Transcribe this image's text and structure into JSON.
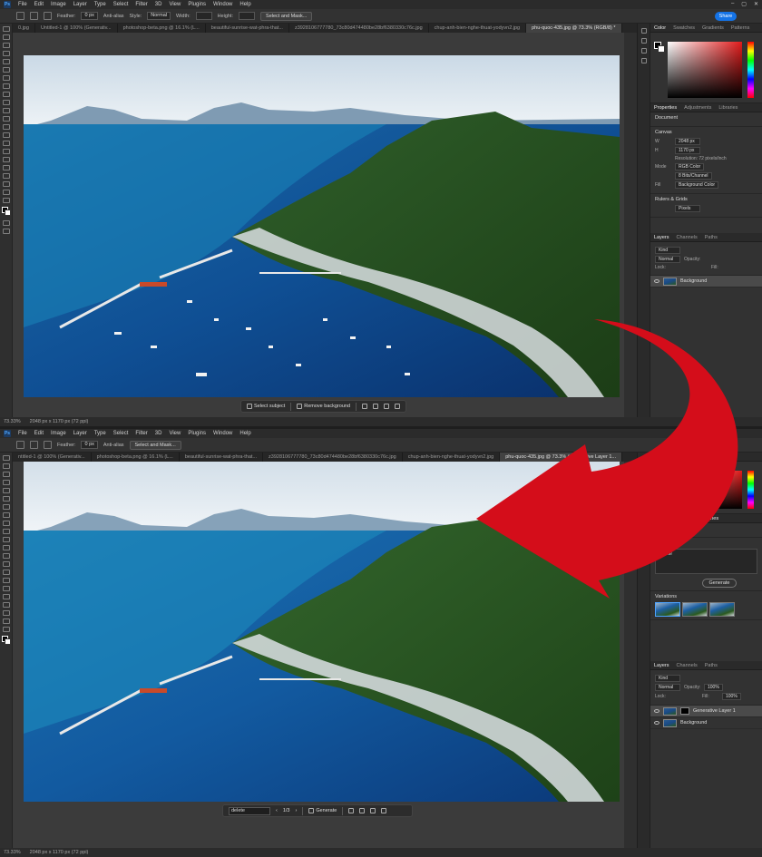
{
  "menu": [
    "File",
    "Edit",
    "Image",
    "Layer",
    "Type",
    "Select",
    "Filter",
    "3D",
    "View",
    "Plugins",
    "Window",
    "Help"
  ],
  "app_logo": "Ps",
  "window_controls": [
    "–",
    "▢",
    "✕"
  ],
  "top": {
    "options": {
      "feather_label": "Feather:",
      "feather_value": "0 px",
      "antialias": "Anti-alias",
      "style_label": "Style:",
      "style_value": "Normal",
      "width_label": "Width:",
      "height_label": "Height:",
      "select_mask": "Select and Mask..."
    },
    "share": "Share",
    "tabs": [
      "0.jpg",
      "Untitled-1 @ 100% (Generativ...",
      "photoshop-beta.png @ 16.1% (L...",
      "beautiful-sunrise-wat-phra-that...",
      "z3928106777780_73c80d474480be28bf6380330c76c.jpg",
      "chup-anh-bien-nghe-thuat-yodyvn2.jpg",
      "phu-quoc-435.jpg @ 73.3% (RGB/8) *"
    ],
    "context_bar": {
      "select_subject": "Select subject",
      "remove_background": "Remove background"
    },
    "status": {
      "zoom": "73.33%",
      "info": "2048 px x 1170 px (72 ppi)"
    },
    "color_tabs": [
      "Color",
      "Swatches",
      "Gradients",
      "Patterns"
    ],
    "props_tabs": [
      "Properties",
      "Adjustments",
      "Libraries"
    ],
    "document": "Document",
    "canvas": {
      "title": "Canvas",
      "w_label": "W",
      "w": "2048 px",
      "h_label": "H",
      "h": "1170 px",
      "resolution": "Resolution: 72 pixels/inch",
      "mode_label": "Mode",
      "mode": "RGB Color",
      "bits": "8 Bits/Channel",
      "fill_label": "Fill",
      "fill": "Background Color"
    },
    "rulers": {
      "title": "Rulers & Grids",
      "unit": "Pixels"
    },
    "layers_tabs": [
      "Layers",
      "Channels",
      "Paths"
    ],
    "layers": {
      "kind": "Kind",
      "blend": "Normal",
      "opacity_label": "Opacity:",
      "fill_label": "Fill:",
      "lock_label": "Lock:",
      "items": [
        "Background"
      ]
    }
  },
  "bottom": {
    "options": {
      "feather_label": "Feather:",
      "feather_value": "0 px",
      "antialias": "Anti-alias",
      "select_mask": "Select and Mask..."
    },
    "tabs": [
      "ntitled-1 @ 100% (Generativ...",
      "photoshop-beta.png @ 16.1% (L...",
      "beautiful-sunrise-wat-phra-that...",
      "z3928106777780_73c80d474480be28bf6380330c76c.jpg",
      "chup-anh-bien-nghe-thuat-yodyvn2.jpg",
      "phu-quoc-435.jpg @ 73.3% (Generative Layer 1..."
    ],
    "context_bar": {
      "prompt": "delete",
      "counter": "1/3",
      "generate": "Generate"
    },
    "status": {
      "zoom": "73.33%",
      "info": "2048 px x 1170 px (72 ppi)"
    },
    "color_tabs": [
      "Color"
    ],
    "props_tabs": [
      "Libraries"
    ],
    "gen_layer": "Generative Layer",
    "prompt_label": "Prompt",
    "prompt_value": "delete",
    "generate_btn": "Generate",
    "variations_label": "Variations",
    "layers_tabs": [
      "Layers",
      "Channels",
      "Paths"
    ],
    "layers": {
      "kind": "Kind",
      "blend": "Normal",
      "opacity_label": "Opacity:",
      "opacity": "100%",
      "fill_label": "Fill:",
      "fill": "100%",
      "lock_label": "Lock:",
      "items": [
        "Generative Layer 1",
        "Background"
      ]
    }
  },
  "colors": {
    "arrow": "#d40d1a",
    "accent": "#1473e6"
  }
}
